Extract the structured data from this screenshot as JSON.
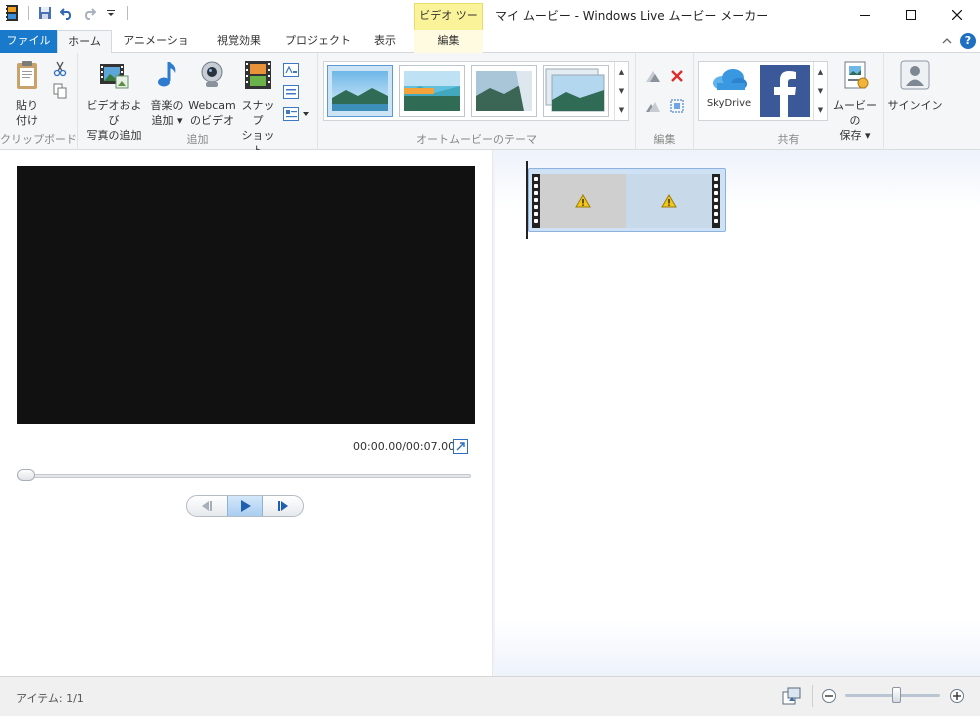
{
  "titlebar": {
    "context_tab_group": "ビデオ ツール",
    "title": "マイ ムービー - Windows Live ムービー メーカー"
  },
  "tabs": {
    "file": "ファイル",
    "home": "ホーム",
    "animation": "アニメーション",
    "visual_effects": "視覚効果",
    "project": "プロジェクト",
    "view": "表示",
    "edit": "編集"
  },
  "ribbon": {
    "clipboard": {
      "paste_line1": "貼り",
      "paste_line2": "付け",
      "label": "クリップボード"
    },
    "add": {
      "add_videos_line1": "ビデオおよび",
      "add_videos_line2": "写真の追加",
      "add_music_line1": "音楽の",
      "add_music_line2": "追加 ▾",
      "webcam_line1": "Webcam",
      "webcam_line2": "のビデオ",
      "snapshot_line1": "スナップ",
      "snapshot_line2": "ショット",
      "label": "追加"
    },
    "automovie": {
      "label": "オートムービーのテーマ"
    },
    "editing": {
      "label": "編集"
    },
    "share": {
      "skydrive": "SkyDrive",
      "save_movie_line1": "ムービーの",
      "save_movie_line2": "保存 ▾",
      "label": "共有"
    },
    "signin": {
      "label": "サインイン"
    }
  },
  "preview": {
    "timecode": "00:00.00/00:07.00",
    "progress": 0.0
  },
  "status": {
    "items": "アイテム: 1/1",
    "zoom_level": 0.55
  },
  "colors": {
    "file_tab": "#1979ca",
    "context_tab": "#fbf39a",
    "preview_bg": "#111111",
    "clip_border": "#8db2dd"
  }
}
